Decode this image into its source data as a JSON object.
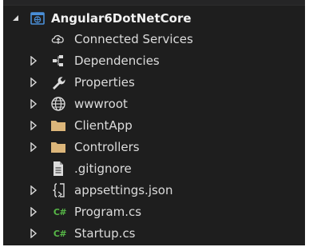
{
  "solution_explorer": {
    "project": {
      "label": "Angular6DotNetCore",
      "icon": "web-project-icon",
      "expanded": true
    },
    "items": [
      {
        "label": "Connected Services",
        "icon": "connected-services-icon",
        "expandable": false
      },
      {
        "label": "Dependencies",
        "icon": "dependencies-icon",
        "expandable": true
      },
      {
        "label": "Properties",
        "icon": "wrench-icon",
        "expandable": true
      },
      {
        "label": "wwwroot",
        "icon": "globe-icon",
        "expandable": true
      },
      {
        "label": "ClientApp",
        "icon": "folder-icon",
        "expandable": true
      },
      {
        "label": "Controllers",
        "icon": "folder-icon",
        "expandable": true
      },
      {
        "label": ".gitignore",
        "icon": "file-icon",
        "expandable": false
      },
      {
        "label": "appsettings.json",
        "icon": "json-file-icon",
        "expandable": true
      },
      {
        "label": "Program.cs",
        "icon": "csharp-file-icon",
        "expandable": true
      },
      {
        "label": "Startup.cs",
        "icon": "csharp-file-icon",
        "expandable": true
      }
    ],
    "icon_text": {
      "csharp": "C#"
    },
    "colors": {
      "background": "#1e1e1e",
      "text": "#dcdcdc",
      "folder": "#dcb67a",
      "csharp": "#57b847",
      "project_icon": "#4a8fd8"
    }
  }
}
